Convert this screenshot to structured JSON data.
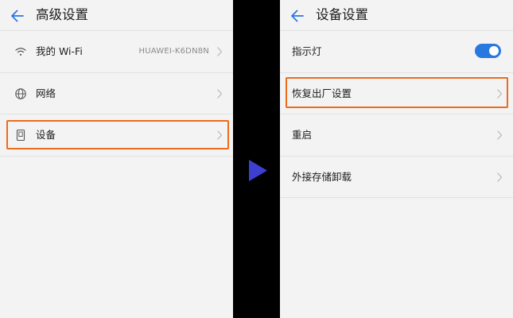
{
  "left_screen": {
    "title": "高级设置",
    "items": [
      {
        "label": "我的 Wi-Fi",
        "value": "HUAWEI-K6DN8N",
        "icon": "wifi-icon"
      },
      {
        "label": "网络",
        "icon": "globe-icon"
      },
      {
        "label": "设备",
        "icon": "device-icon",
        "highlighted": true
      }
    ]
  },
  "right_screen": {
    "title": "设备设置",
    "items": [
      {
        "label": "指示灯",
        "toggle": true,
        "toggle_on": true
      },
      {
        "label": "恢复出厂设置",
        "highlighted": true
      },
      {
        "label": "重启"
      },
      {
        "label": "外接存储卸载"
      }
    ]
  },
  "colors": {
    "accent": "#2878e0",
    "highlight": "#ec6b1e",
    "arrow": "#3d3fd0",
    "background": "#f3f3f3",
    "divider": "#000000"
  }
}
